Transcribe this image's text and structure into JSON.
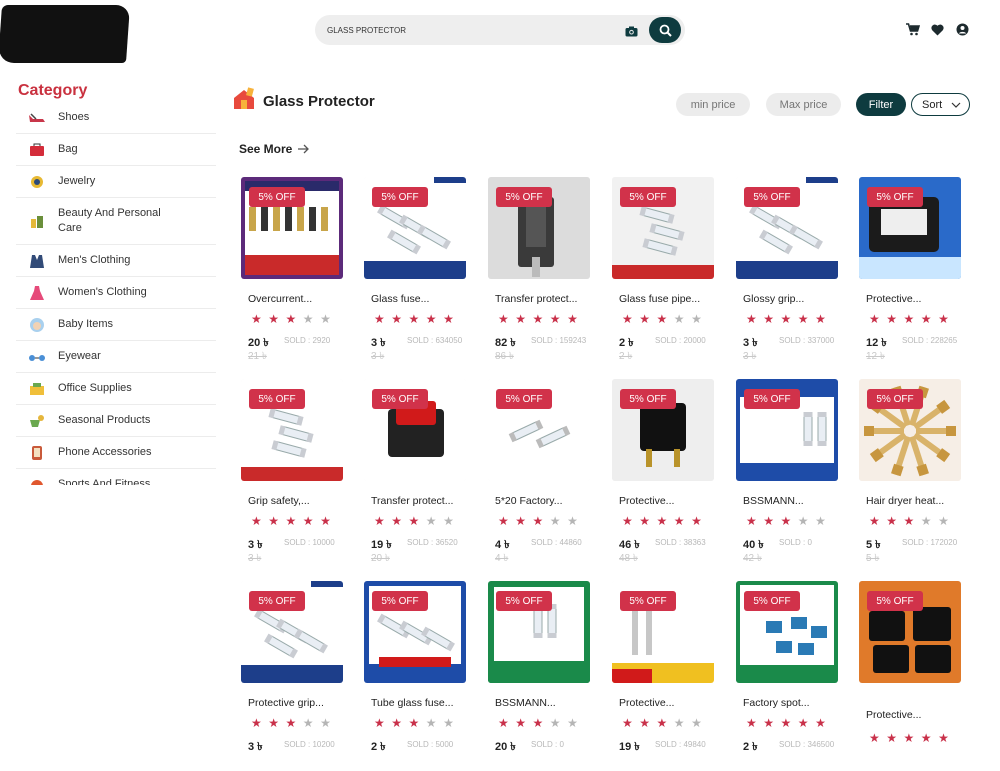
{
  "header": {
    "search_value": "GLASS PROTECTOR",
    "icons": [
      "camera-icon",
      "search-icon",
      "cart-icon",
      "heart-icon",
      "account-icon"
    ]
  },
  "sidebar": {
    "title": "Category",
    "items": [
      {
        "label": "Shoes",
        "icon": "shoe-icon"
      },
      {
        "label": "Bag",
        "icon": "bag-icon"
      },
      {
        "label": "Jewelry",
        "icon": "jewelry-icon"
      },
      {
        "label": "Beauty And Personal Care",
        "icon": "beauty-icon"
      },
      {
        "label": "Men's Clothing",
        "icon": "mens-clothing-icon"
      },
      {
        "label": "Women's Clothing",
        "icon": "womens-clothing-icon"
      },
      {
        "label": "Baby Items",
        "icon": "baby-icon"
      },
      {
        "label": "Eyewear",
        "icon": "eyewear-icon"
      },
      {
        "label": "Office Supplies",
        "icon": "office-icon"
      },
      {
        "label": "Seasonal Products",
        "icon": "seasonal-icon"
      },
      {
        "label": "Phone Accessories",
        "icon": "phone-icon"
      },
      {
        "label": "Sports And Fitness",
        "icon": "sports-icon"
      }
    ]
  },
  "page": {
    "title": "Glass Protector",
    "min_price_placeholder": "min price",
    "max_price_placeholder": "Max price",
    "filter_label": "Filter",
    "sort_label": "Sort",
    "see_more": "See More"
  },
  "colors": {
    "accent": "#0e3b3f",
    "discount": "#d1324a",
    "star_on": "#c9314a",
    "star_off": "#b5b5b5"
  },
  "products": [
    {
      "name": "Overcurrent...",
      "discount": "5% OFF",
      "rating": 3,
      "price": "20 ৳",
      "sold": "SOLD : 2920",
      "old_price": "21 ৳",
      "bg": "#5c2a7a",
      "thumb": "fuse-board"
    },
    {
      "name": "Glass fuse...",
      "discount": "5% OFF",
      "rating": 5,
      "price": "3 ৳",
      "sold": "SOLD : 634050",
      "old_price": "3 ৳",
      "bg": "#ffffff",
      "thumb": "fuses-blue"
    },
    {
      "name": "Transfer protect...",
      "discount": "5% OFF",
      "rating": 5,
      "price": "82 ৳",
      "sold": "SOLD : 159243",
      "old_price": "86 ৳",
      "bg": "#dcdcdc",
      "thumb": "switch"
    },
    {
      "name": "Glass fuse pipe...",
      "discount": "5% OFF",
      "rating": 3,
      "price": "2 ৳",
      "sold": "SOLD : 20000",
      "old_price": "2 ৳",
      "bg": "#f1f1f1",
      "thumb": "fuse-red"
    },
    {
      "name": "Glossy grip...",
      "discount": "5% OFF",
      "rating": 5,
      "price": "3 ৳",
      "sold": "SOLD : 337000",
      "old_price": "3 ৳",
      "bg": "#ffffff",
      "thumb": "fuses-blue"
    },
    {
      "name": "Protective...",
      "discount": "5% OFF",
      "rating": 5,
      "price": "12 ৳",
      "sold": "SOLD : 228265",
      "old_price": "12 ৳",
      "bg": "#2a6ac9",
      "thumb": "blue-part"
    },
    {
      "name": "Grip safety,...",
      "discount": "5% OFF",
      "rating": 5,
      "price": "3 ৳",
      "sold": "SOLD : 10000",
      "old_price": "3 ৳",
      "bg": "#ffffff",
      "thumb": "fuse-red"
    },
    {
      "name": "Transfer protect...",
      "discount": "5% OFF",
      "rating": 3,
      "price": "19 ৳",
      "sold": "SOLD : 36520",
      "old_price": "20 ৳",
      "bg": "#ffffff",
      "thumb": "rocker"
    },
    {
      "name": "5*20 Factory...",
      "discount": "5% OFF",
      "rating": 3,
      "price": "4 ৳",
      "sold": "SOLD : 44860",
      "old_price": "4 ৳",
      "bg": "#ffffff",
      "thumb": "glass-fuse"
    },
    {
      "name": "Protective...",
      "discount": "5% OFF",
      "rating": 5,
      "price": "46 ৳",
      "sold": "SOLD : 38363",
      "old_price": "48 ৳",
      "bg": "#eeeeee",
      "thumb": "breaker"
    },
    {
      "name": "BSSMANN...",
      "discount": "5% OFF",
      "rating": 3,
      "price": "40 ৳",
      "sold": "SOLD : 0",
      "old_price": "42 ৳",
      "bg": "#1e4ca8",
      "thumb": "eaton"
    },
    {
      "name": "Hair dryer heat...",
      "discount": "5% OFF",
      "rating": 3,
      "price": "5 ৳",
      "sold": "SOLD : 172020",
      "old_price": "5 ৳",
      "bg": "#f6eee6",
      "thumb": "thermal"
    },
    {
      "name": "Protective grip...",
      "discount": "5% OFF",
      "rating": 3,
      "price": "3 ৳",
      "sold": "SOLD : 10200",
      "old_price": "",
      "bg": "#ffffff",
      "thumb": "fuses-blue"
    },
    {
      "name": "Tube glass fuse...",
      "discount": "5% OFF",
      "rating": 3,
      "price": "2 ৳",
      "sold": "SOLD : 5000",
      "old_price": "",
      "bg": "#ffffff",
      "thumb": "fuse-blue-frame"
    },
    {
      "name": "BSSMANN...",
      "discount": "5% OFF",
      "rating": 3,
      "price": "20 ৳",
      "sold": "SOLD : 0",
      "old_price": "",
      "bg": "#1a8a4a",
      "thumb": "eaton-green"
    },
    {
      "name": "Protective...",
      "discount": "5% OFF",
      "rating": 3,
      "price": "19 ৳",
      "sold": "SOLD : 49840",
      "old_price": "",
      "bg": "#ffffff",
      "thumb": "fuse-yellow"
    },
    {
      "name": "Factory spot...",
      "discount": "5% OFF",
      "rating": 5,
      "price": "2 ৳",
      "sold": "SOLD : 346500",
      "old_price": "",
      "bg": "#1a8a4a",
      "thumb": "blue-blocks"
    },
    {
      "name": "Protective...",
      "discount": "5% OFF",
      "rating": 5,
      "price": "",
      "sold": "",
      "old_price": "",
      "bg": "#e07a2a",
      "thumb": "black-breakers"
    }
  ]
}
